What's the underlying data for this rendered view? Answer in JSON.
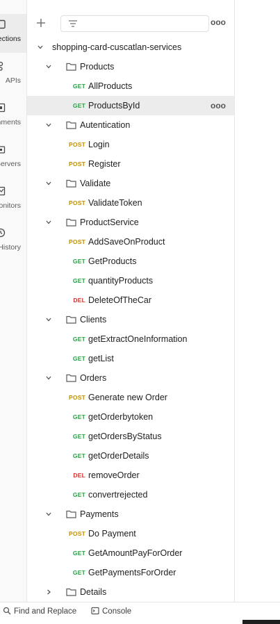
{
  "rail": {
    "items": [
      {
        "label": "Collections",
        "icon": "collections-icon",
        "active": true
      },
      {
        "label": "APIs",
        "icon": "api-icon",
        "active": false
      },
      {
        "label": "Environments",
        "icon": "environments-icon",
        "active": false
      },
      {
        "label": "Mock Servers",
        "icon": "mock-servers-icon",
        "active": false
      },
      {
        "label": "Monitors",
        "icon": "monitors-icon",
        "active": false
      },
      {
        "label": "History",
        "icon": "history-icon",
        "active": false
      }
    ]
  },
  "toolbar": {
    "add_icon": "plus-icon",
    "filter_icon": "filter-icon",
    "filter_placeholder": "",
    "more_label": "ooo"
  },
  "tree": {
    "collection": "shopping-card-cuscatlan-services",
    "rows": [
      {
        "kind": "folder",
        "label": "Products",
        "expanded": true
      },
      {
        "kind": "request",
        "method": "GET",
        "label": "AllProducts"
      },
      {
        "kind": "request",
        "method": "GET",
        "label": "ProductsById",
        "selected": true
      },
      {
        "kind": "folder",
        "label": "Autentication",
        "expanded": true
      },
      {
        "kind": "request",
        "method": "POST",
        "label": "Login"
      },
      {
        "kind": "request",
        "method": "POST",
        "label": "Register"
      },
      {
        "kind": "folder",
        "label": "Validate",
        "expanded": true
      },
      {
        "kind": "request",
        "method": "POST",
        "label": "ValidateToken"
      },
      {
        "kind": "folder",
        "label": "ProductService",
        "expanded": true
      },
      {
        "kind": "request",
        "method": "POST",
        "label": "AddSaveOnProduct"
      },
      {
        "kind": "request",
        "method": "GET",
        "label": "GetProducts"
      },
      {
        "kind": "request",
        "method": "GET",
        "label": "quantityProducts"
      },
      {
        "kind": "request",
        "method": "DEL",
        "label": "DeleteOfTheCar"
      },
      {
        "kind": "folder",
        "label": "Clients",
        "expanded": true
      },
      {
        "kind": "request",
        "method": "GET",
        "label": "getExtractOneInformation"
      },
      {
        "kind": "request",
        "method": "GET",
        "label": "getList"
      },
      {
        "kind": "folder",
        "label": "Orders",
        "expanded": true
      },
      {
        "kind": "request",
        "method": "POST",
        "label": "Generate new Order"
      },
      {
        "kind": "request",
        "method": "GET",
        "label": "getOrderbytoken"
      },
      {
        "kind": "request",
        "method": "GET",
        "label": "getOrdersByStatus"
      },
      {
        "kind": "request",
        "method": "GET",
        "label": "getOrderDetails"
      },
      {
        "kind": "request",
        "method": "DEL",
        "label": "removeOrder"
      },
      {
        "kind": "request",
        "method": "GET",
        "label": "convertrejected"
      },
      {
        "kind": "folder",
        "label": "Payments",
        "expanded": true
      },
      {
        "kind": "request",
        "method": "POST",
        "label": "Do Payment"
      },
      {
        "kind": "request",
        "method": "GET",
        "label": "GetAmountPayForOrder"
      },
      {
        "kind": "request",
        "method": "GET",
        "label": "GetPaymentsForOrder"
      },
      {
        "kind": "folder",
        "label": "Details",
        "expanded": false
      }
    ],
    "row_more_label": "ooo"
  },
  "statusbar": {
    "find_replace": "Find and Replace",
    "console": "Console"
  },
  "colors": {
    "get": "#29a144",
    "post": "#c49000",
    "del": "#d0342c",
    "selected_row": "#ececec"
  }
}
